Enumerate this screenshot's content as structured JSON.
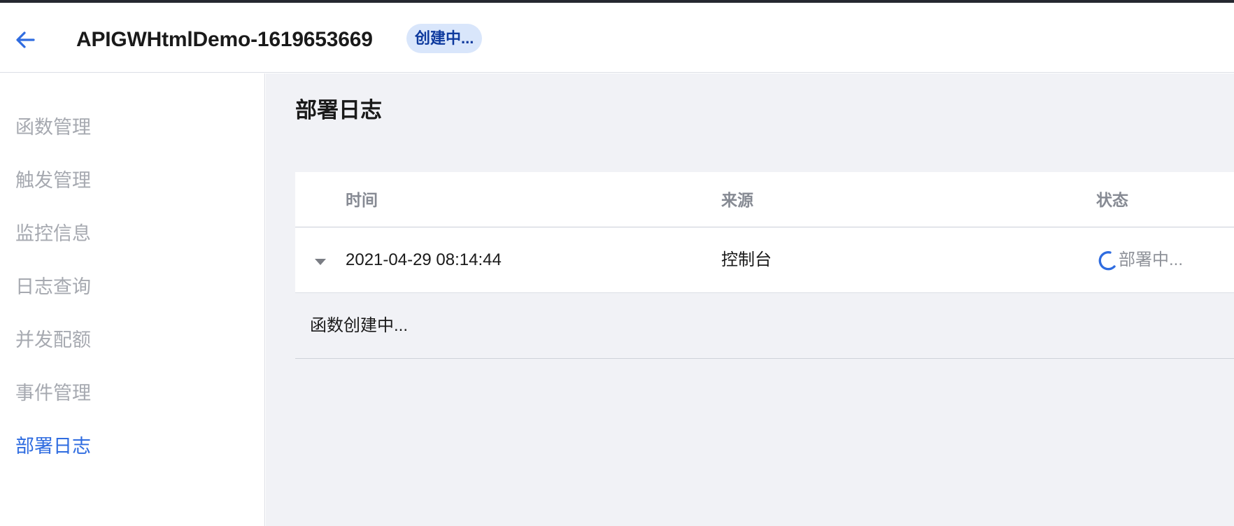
{
  "header": {
    "title": "APIGWHtmlDemo-1619653669",
    "status_badge": "创建中..."
  },
  "sidebar": {
    "items": [
      {
        "label": "函数管理",
        "active": false
      },
      {
        "label": "触发管理",
        "active": false
      },
      {
        "label": "监控信息",
        "active": false
      },
      {
        "label": "日志查询",
        "active": false
      },
      {
        "label": "并发配额",
        "active": false
      },
      {
        "label": "事件管理",
        "active": false
      },
      {
        "label": "部署日志",
        "active": true
      }
    ]
  },
  "main": {
    "title": "部署日志",
    "table": {
      "columns": [
        "时间",
        "来源",
        "状态"
      ],
      "rows": [
        {
          "time": "2021-04-29 08:14:44",
          "source": "控制台",
          "status": "部署中...",
          "detail": "函数创建中..."
        }
      ]
    }
  },
  "colors": {
    "accent": "#2f6ce0",
    "badge_bg": "#d9e6fb",
    "badge_text": "#0e3a9e",
    "content_bg": "#f1f2f6",
    "inactive_text": "#a6a9b0"
  },
  "icons": {
    "back": "arrow-left-icon",
    "expand": "caret-down-icon",
    "loading": "spinner-icon"
  }
}
